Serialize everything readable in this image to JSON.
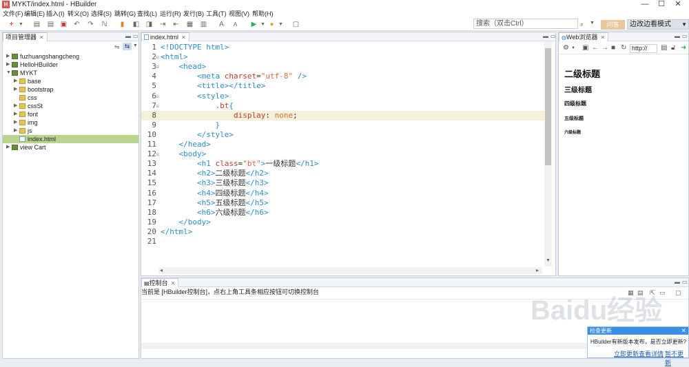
{
  "window": {
    "title": "MYKT/index.html  -  HBuilder",
    "app_icon": "H",
    "minimize": "—",
    "maximize": "☐",
    "close": "✕"
  },
  "menubar": [
    "文件(F)",
    "编辑(E)",
    "插入(I)",
    "转义(O)",
    "选择(S)",
    "跳转(G)",
    "查找(L)",
    "运行(R)",
    "发行(B)",
    "工具(T)",
    "视图(V)",
    "帮助(H)"
  ],
  "toolbar": {
    "search_placeholder": "搜索（双击Ctrl）",
    "search_icon": "search-icon",
    "qa_label": "问答",
    "mode_label": "边改边看模式"
  },
  "project_panel": {
    "title": "项目管理器",
    "tree": [
      {
        "label": "fuzhuangshangcheng",
        "depth": 0,
        "kind": "project",
        "expanded": false,
        "selected": false
      },
      {
        "label": "HelloHBuilder",
        "depth": 0,
        "kind": "project",
        "expanded": false,
        "selected": false
      },
      {
        "label": "MYKT",
        "depth": 0,
        "kind": "project",
        "expanded": true,
        "selected": false
      },
      {
        "label": "base",
        "depth": 1,
        "kind": "folder",
        "expanded": false,
        "selected": false
      },
      {
        "label": "bootstrap",
        "depth": 1,
        "kind": "folder",
        "expanded": false,
        "selected": false
      },
      {
        "label": "css",
        "depth": 1,
        "kind": "folder",
        "expanded": null,
        "selected": false
      },
      {
        "label": "cssSt",
        "depth": 1,
        "kind": "folder",
        "expanded": false,
        "selected": false
      },
      {
        "label": "font",
        "depth": 1,
        "kind": "folder",
        "expanded": false,
        "selected": false
      },
      {
        "label": "img",
        "depth": 1,
        "kind": "folder",
        "expanded": false,
        "selected": false
      },
      {
        "label": "js",
        "depth": 1,
        "kind": "folder",
        "expanded": false,
        "selected": false
      },
      {
        "label": "index.html",
        "depth": 1,
        "kind": "html",
        "expanded": null,
        "selected": true
      },
      {
        "label": "view Cart",
        "depth": 0,
        "kind": "project",
        "expanded": false,
        "selected": false
      }
    ]
  },
  "editor": {
    "tab_label": "index.html",
    "highlight_line": 8,
    "lines": [
      {
        "n": "1",
        "fold": "",
        "tokens": [
          [
            "t-tag",
            "<!DOCTYPE html>"
          ]
        ]
      },
      {
        "n": "2",
        "fold": "⊟",
        "tokens": [
          [
            "t-tag",
            "<html>"
          ]
        ]
      },
      {
        "n": "3",
        "fold": "⊟",
        "tokens": [
          [
            "t-txt",
            "    "
          ],
          [
            "t-tag",
            "<head>"
          ]
        ]
      },
      {
        "n": "4",
        "fold": "",
        "tokens": [
          [
            "t-txt",
            "        "
          ],
          [
            "t-tag",
            "<meta "
          ],
          [
            "t-attr",
            "charset"
          ],
          [
            "t-punc",
            "="
          ],
          [
            "t-val",
            "\"utf-8\""
          ],
          [
            "t-tag",
            " />"
          ]
        ]
      },
      {
        "n": "5",
        "fold": "",
        "tokens": [
          [
            "t-txt",
            "        "
          ],
          [
            "t-tag",
            "<title></title>"
          ]
        ]
      },
      {
        "n": "6",
        "fold": "⊟",
        "tokens": [
          [
            "t-txt",
            "        "
          ],
          [
            "t-tag",
            "<style>"
          ]
        ]
      },
      {
        "n": "7",
        "fold": "⊟",
        "tokens": [
          [
            "t-txt",
            "            "
          ],
          [
            "t-attr",
            ".bt"
          ],
          [
            "t-tag",
            "{"
          ]
        ]
      },
      {
        "n": "8",
        "fold": "",
        "tokens": [
          [
            "t-txt",
            "                "
          ],
          [
            "t-attr",
            "display"
          ],
          [
            "t-punc",
            ": "
          ],
          [
            "t-val",
            "none"
          ],
          [
            "t-punc",
            ";"
          ]
        ]
      },
      {
        "n": "9",
        "fold": "",
        "tokens": [
          [
            "t-txt",
            "            "
          ],
          [
            "t-tag",
            "}"
          ]
        ]
      },
      {
        "n": "10",
        "fold": "",
        "tokens": [
          [
            "t-txt",
            "        "
          ],
          [
            "t-tag",
            "</style>"
          ]
        ]
      },
      {
        "n": "11",
        "fold": "",
        "tokens": [
          [
            "t-txt",
            "    "
          ],
          [
            "t-tag",
            "</head>"
          ]
        ]
      },
      {
        "n": "12",
        "fold": "⊟",
        "tokens": [
          [
            "t-txt",
            "    "
          ],
          [
            "t-tag",
            "<body>"
          ]
        ]
      },
      {
        "n": "13",
        "fold": "",
        "tokens": [
          [
            "t-txt",
            "        "
          ],
          [
            "t-tag",
            "<h1 "
          ],
          [
            "t-attr",
            "class"
          ],
          [
            "t-punc",
            "="
          ],
          [
            "t-val",
            "\"bt\""
          ],
          [
            "t-tag",
            ">"
          ],
          [
            "t-txt",
            "一级标题"
          ],
          [
            "t-tag",
            "</h1>"
          ]
        ]
      },
      {
        "n": "14",
        "fold": "",
        "tokens": [
          [
            "t-txt",
            "        "
          ],
          [
            "t-tag",
            "<h2>"
          ],
          [
            "t-txt",
            "二级标题"
          ],
          [
            "t-tag",
            "</h2>"
          ]
        ]
      },
      {
        "n": "15",
        "fold": "",
        "tokens": [
          [
            "t-txt",
            "        "
          ],
          [
            "t-tag",
            "<h3>"
          ],
          [
            "t-txt",
            "三级标题"
          ],
          [
            "t-tag",
            "</h3>"
          ]
        ]
      },
      {
        "n": "16",
        "fold": "",
        "tokens": [
          [
            "t-txt",
            "        "
          ],
          [
            "t-tag",
            "<h4>"
          ],
          [
            "t-txt",
            "四级标题"
          ],
          [
            "t-tag",
            "</h4>"
          ]
        ]
      },
      {
        "n": "17",
        "fold": "",
        "tokens": [
          [
            "t-txt",
            "        "
          ],
          [
            "t-tag",
            "<h5>"
          ],
          [
            "t-txt",
            "五级标题"
          ],
          [
            "t-tag",
            "</h5>"
          ]
        ]
      },
      {
        "n": "18",
        "fold": "",
        "tokens": [
          [
            "t-txt",
            "        "
          ],
          [
            "t-tag",
            "<h6>"
          ],
          [
            "t-txt",
            "六级标题"
          ],
          [
            "t-tag",
            "</h6>"
          ]
        ]
      },
      {
        "n": "19",
        "fold": "",
        "tokens": [
          [
            "t-txt",
            "    "
          ],
          [
            "t-tag",
            "</body>"
          ]
        ]
      },
      {
        "n": "20",
        "fold": "",
        "tokens": [
          [
            "t-tag",
            "</html>"
          ]
        ]
      },
      {
        "n": "21",
        "fold": "",
        "tokens": []
      }
    ]
  },
  "browser": {
    "tab_label": "Web浏览器",
    "address": "http://",
    "headings": [
      "二级标题",
      "三级标题",
      "四级标题",
      "五级标题",
      "六级标题"
    ]
  },
  "console": {
    "tab_label": "控制台",
    "message": "当前是 [HBuilder控制台]，点右上角工具条相应按钮可切换控制台"
  },
  "update_popup": {
    "title": "检查更新",
    "message": "HBuilder有新版本发布，是否立即更新?",
    "update_now": "立即更新",
    "view_details": "查看详情",
    "later": "暂不更新"
  },
  "watermark": "Baidu经验"
}
